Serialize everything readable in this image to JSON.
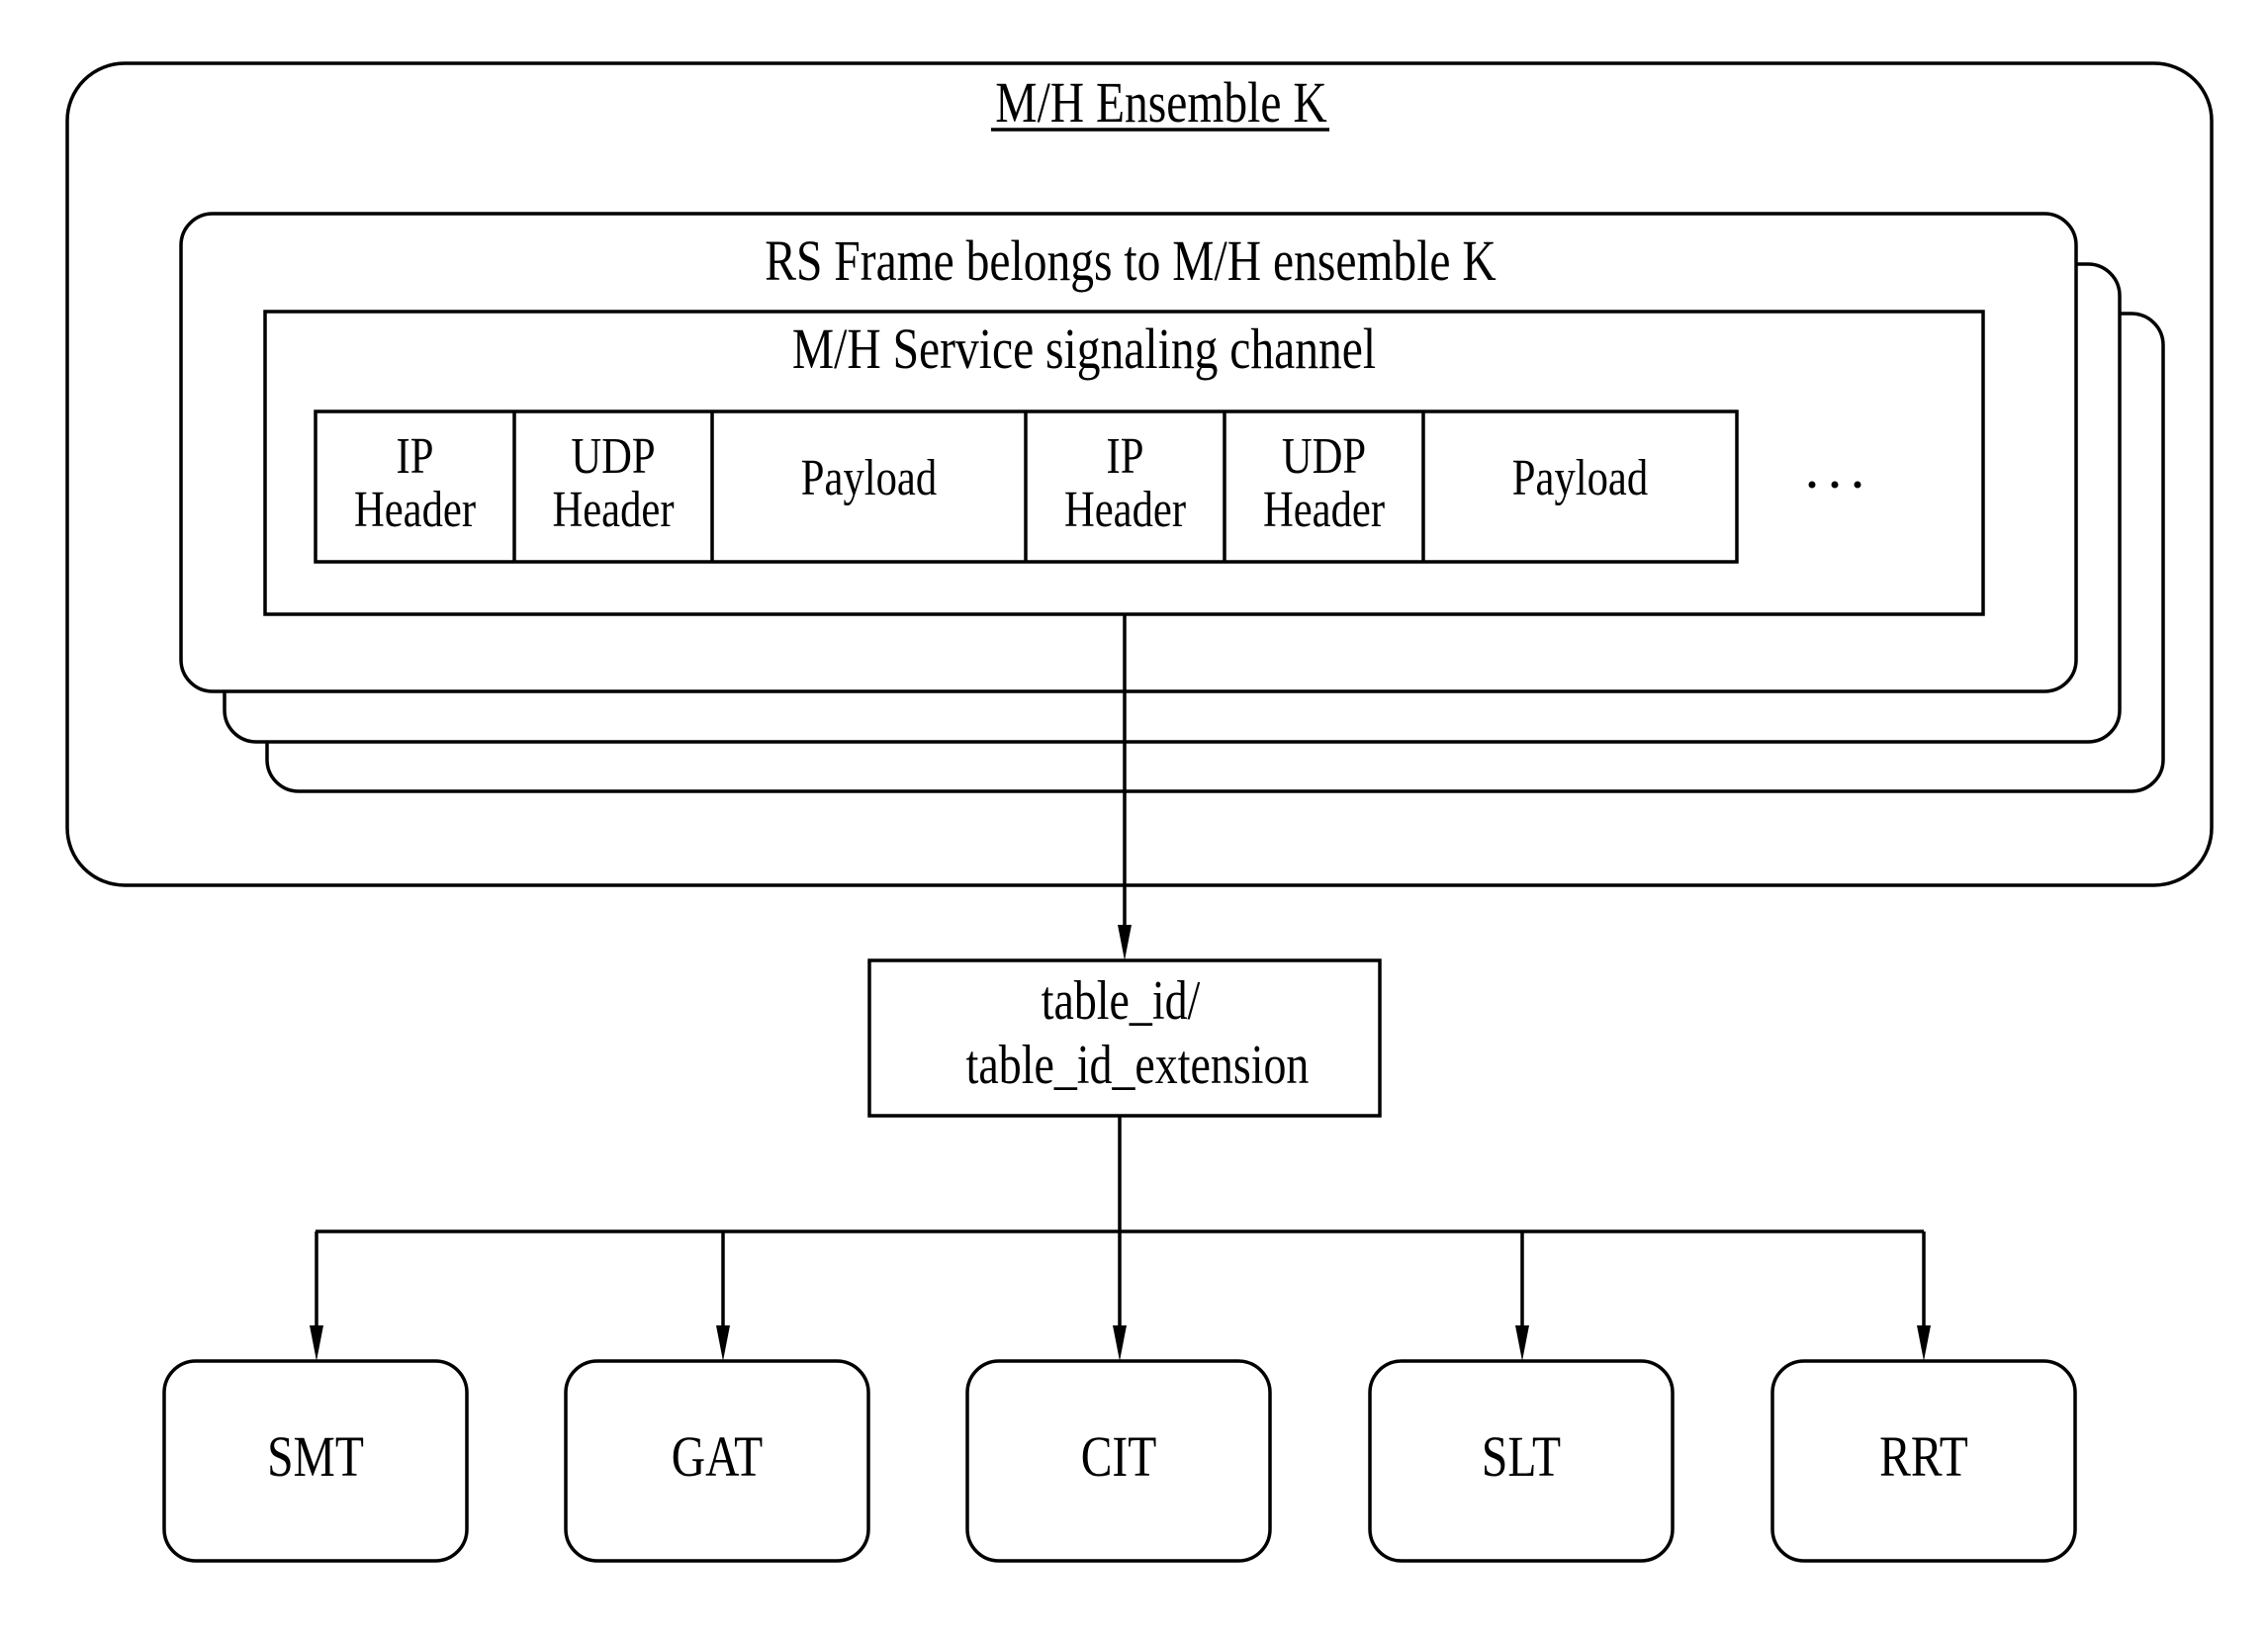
{
  "diagram": {
    "ensemble_title": "M/H Ensemble K",
    "rs_frame_title": "RS Frame belongs to M/H ensemble K",
    "rs_frame_stack_count": 3,
    "channel_title": "M/H Service signaling channel",
    "packet_cells": [
      {
        "line1": "IP",
        "line2": "Header"
      },
      {
        "line1": "UDP",
        "line2": "Header"
      },
      {
        "line1": "Payload",
        "line2": ""
      },
      {
        "line1": "IP",
        "line2": "Header"
      },
      {
        "line1": "UDP",
        "line2": "Header"
      },
      {
        "line1": "Payload",
        "line2": ""
      }
    ],
    "ellipsis": "...",
    "table_box": {
      "line1": "table_id/",
      "line2": "table_id_extension"
    },
    "tables": [
      "SMT",
      "GAT",
      "CIT",
      "SLT",
      "RRT"
    ],
    "colors": {
      "stroke": "#000000",
      "background": "#ffffff"
    }
  }
}
